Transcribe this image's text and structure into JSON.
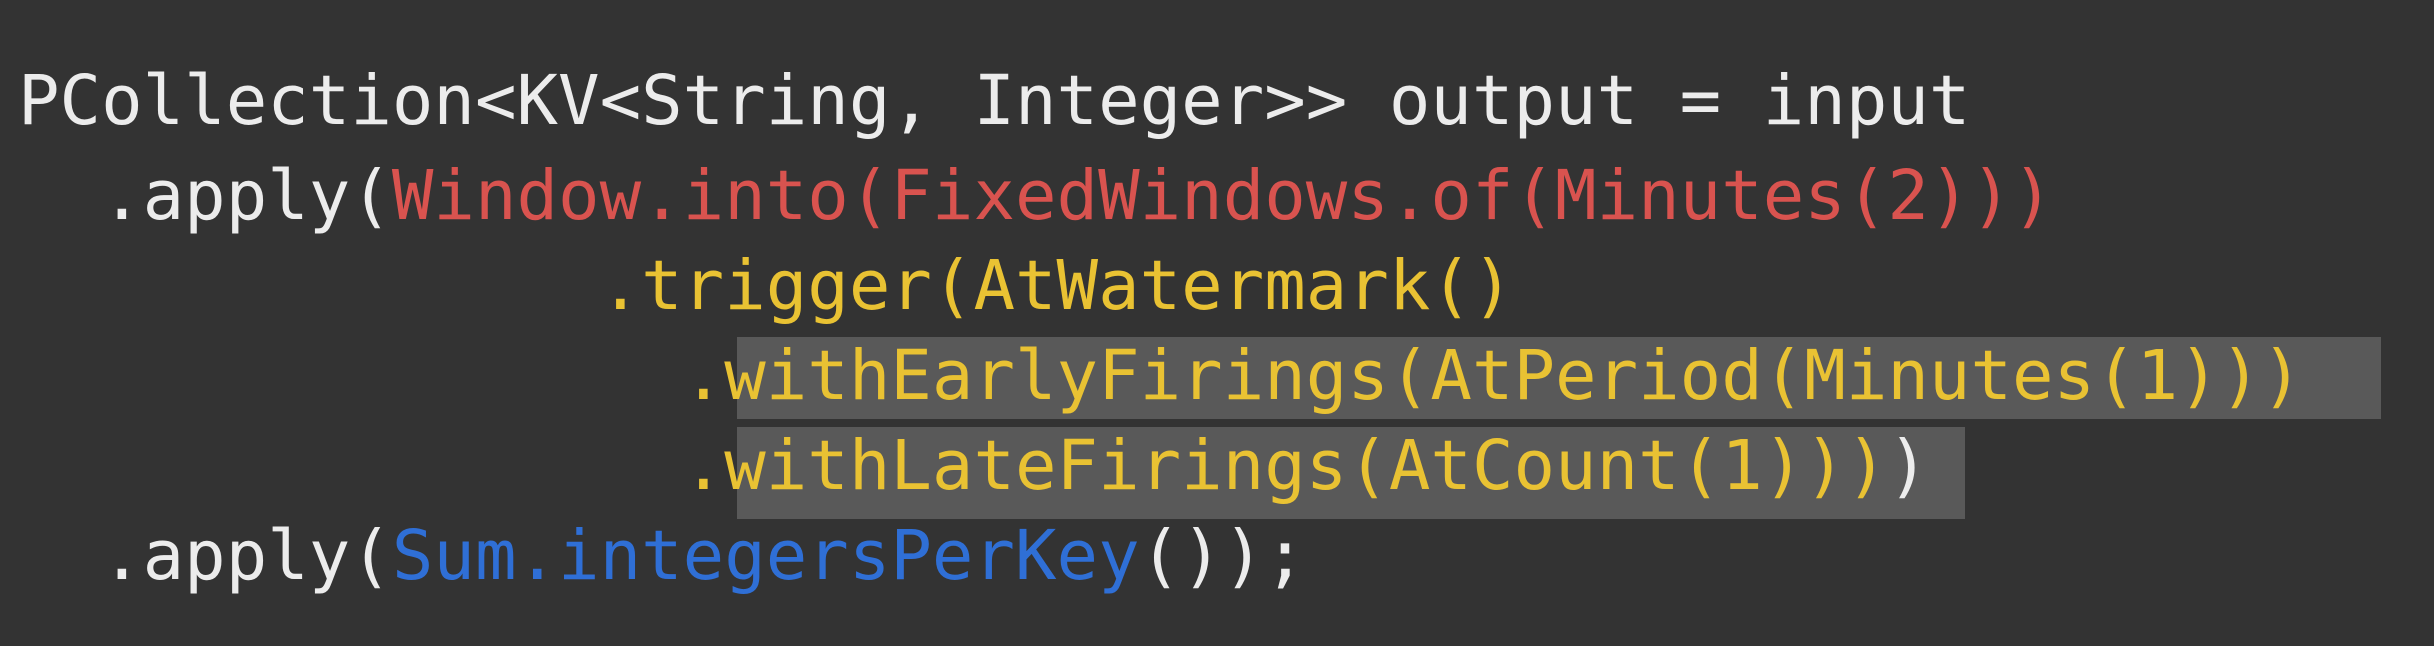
{
  "code": {
    "line1": {
      "declaration": "PCollection<KV<String, Integer>> output = input"
    },
    "line2": {
      "indent": "  ",
      "apply_open": ".apply(",
      "window_expr": "Window.into(FixedWindows.of(Minutes(2)))"
    },
    "line3": {
      "indent": "              ",
      "trigger_expr": ".trigger(AtWatermark()"
    },
    "line4": {
      "indent": "                ",
      "early_firings": ".withEarlyFirings(AtPeriod(Minutes(1)))"
    },
    "line5": {
      "indent": "                ",
      "late_firings": ".withLateFirings(AtCount(1)))",
      "close_paren": ")"
    },
    "line6": {
      "indent": "  ",
      "apply_open": ".apply(",
      "sum_expr": "Sum.integersPerKey",
      "closing": "());"
    }
  },
  "colors": {
    "background": "#333333",
    "plain_text": "#ececec",
    "window_red": "#d9534f",
    "trigger_yellow": "#e9c233",
    "sum_blue": "#2f6fd6",
    "highlight": "#595959"
  }
}
